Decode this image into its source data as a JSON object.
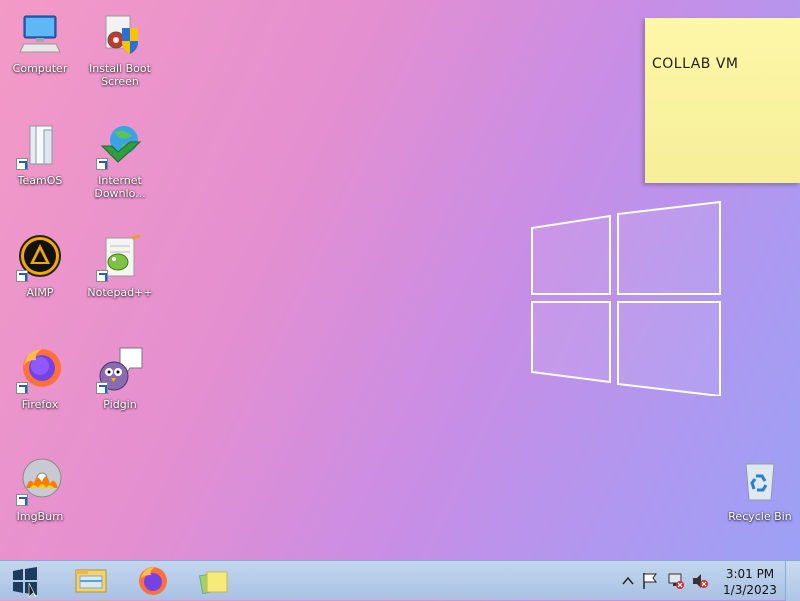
{
  "desktop": {
    "icons": [
      {
        "label": "Computer"
      },
      {
        "label": "Install Boot Screen"
      },
      {
        "label": "TeamOS"
      },
      {
        "label": "Internet Downlo..."
      },
      {
        "label": "AIMP"
      },
      {
        "label": "Notepad++"
      },
      {
        "label": "Firefox"
      },
      {
        "label": "Pidgin"
      },
      {
        "label": "ImgBurn"
      },
      {
        "label": "Recycle Bin"
      }
    ],
    "sticky_note": {
      "text": "COLLAB VM"
    }
  },
  "taskbar": {
    "clock_time": "3:01 PM",
    "clock_date": "1/3/2023",
    "pinned": [
      "file-explorer-icon",
      "firefox-icon",
      "sticky-notes-icon"
    ]
  },
  "colors": {
    "taskbar": "#b5cbe9",
    "sticky": "#fbf4a3"
  }
}
